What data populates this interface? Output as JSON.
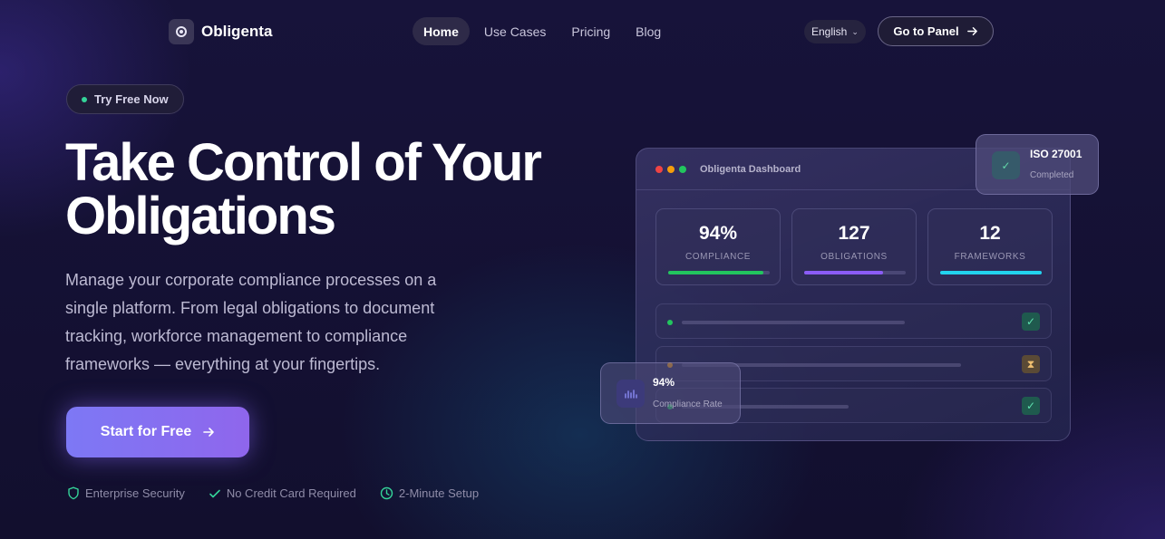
{
  "brand": {
    "name": "Obligenta",
    "logo_icon": "target-icon"
  },
  "nav": {
    "links": [
      {
        "label": "Home",
        "active": true
      },
      {
        "label": "Use Cases",
        "active": false
      },
      {
        "label": "Pricing",
        "active": false
      },
      {
        "label": "Blog",
        "active": false
      }
    ],
    "language": "English",
    "panel_button": "Go to Panel"
  },
  "hero": {
    "badge": "Try Free Now",
    "headline_line1": "Take Control of Your",
    "headline_line2": "Obligations",
    "description": "Manage your corporate compliance processes on a single platform. From legal obligations to document tracking, workforce management to compliance frameworks — everything at your fingertips.",
    "cta": "Start for Free",
    "features": [
      {
        "icon": "shield-icon",
        "label": "Enterprise Security"
      },
      {
        "icon": "check-icon",
        "label": "No Credit Card Required"
      },
      {
        "icon": "clock-icon",
        "label": "2-Minute Setup"
      }
    ]
  },
  "dashboard": {
    "title": "Obligenta Dashboard",
    "stats": [
      {
        "value": "94%",
        "label": "COMPLIANCE",
        "progress": 0.94,
        "color": "#22c55e"
      },
      {
        "value": "127",
        "label": "OBLIGATIONS",
        "progress": 0.78,
        "color": "#8b5cf6"
      },
      {
        "value": "12",
        "label": "FRAMEWORKS",
        "progress": 1.0,
        "color": "#22d3ee"
      }
    ],
    "rows": [
      {
        "status": "done",
        "dot_color": "#22c55e",
        "status_icon": "check-icon"
      },
      {
        "status": "pending",
        "dot_color": "#f59e0b",
        "status_icon": "hourglass-icon"
      },
      {
        "status": "done",
        "dot_color": "#22c55e",
        "status_icon": "check-icon"
      }
    ]
  },
  "floating_cards": {
    "iso": {
      "title": "ISO 27001",
      "subtitle": "Completed",
      "icon": "check-icon"
    },
    "rate": {
      "title": "94%",
      "subtitle": "Compliance Rate",
      "icon": "chart-icon"
    }
  }
}
